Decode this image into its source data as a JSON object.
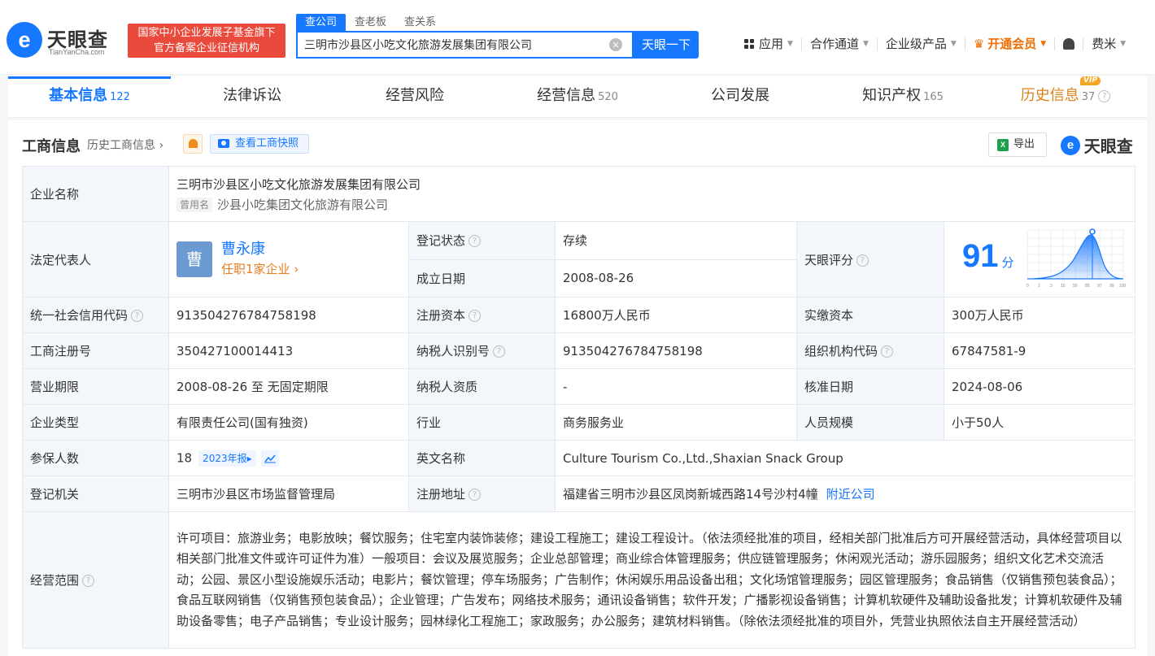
{
  "header": {
    "logo_glyph": "e",
    "logo_text": "天眼查",
    "logo_sub": "TianYanCha.com",
    "slogan_line1": "国家中小企业发展子基金旗下",
    "slogan_line2": "官方备案企业征信机构",
    "search_tabs": [
      "查公司",
      "查老板",
      "查关系"
    ],
    "search_value": "三明市沙县区小吃文化旅游发展集团有限公司",
    "search_clear": "×",
    "search_button": "天眼一下",
    "nav": {
      "apps": "应用",
      "channels": "合作通道",
      "enterprise": "企业级产品",
      "vip": "开通会员",
      "user": "费米"
    }
  },
  "tabs": [
    {
      "label": "基本信息",
      "count": "122"
    },
    {
      "label": "法律诉讼",
      "count": ""
    },
    {
      "label": "经营风险",
      "count": ""
    },
    {
      "label": "经营信息",
      "count": "520"
    },
    {
      "label": "公司发展",
      "count": ""
    },
    {
      "label": "知识产权",
      "count": "165"
    },
    {
      "label": "历史信息",
      "count": "37",
      "badge": "VIP"
    }
  ],
  "section": {
    "title": "工商信息",
    "history_link": "历史工商信息",
    "snapshot": "查看工商快照",
    "export": "导出",
    "brand": "天眼查",
    "brand_glyph": "e"
  },
  "info": {
    "company_name_label": "企业名称",
    "company_name": "三明市沙县区小吃文化旅游发展集团有限公司",
    "former_name_tag": "曾用名",
    "former_name": "沙县小吃集团文化旅游有限公司",
    "legal_rep_label": "法定代表人",
    "legal_avatar": "曹",
    "legal_rep": "曹永康",
    "legal_sub": "任职1家企业",
    "reg_status_label": "登记状态",
    "reg_status": "存续",
    "found_date_label": "成立日期",
    "found_date": "2008-08-26",
    "score_label": "天眼评分",
    "score": "91",
    "score_unit": "分",
    "score_ticks": [
      "0",
      "1",
      "3",
      "15",
      "50",
      "85",
      "97",
      "99",
      "100"
    ],
    "credit_code_label": "统一社会信用代码",
    "credit_code": "913504276784758198",
    "reg_capital_label": "注册资本",
    "reg_capital": "16800万人民币",
    "paid_capital_label": "实缴资本",
    "paid_capital": "300万人民币",
    "reg_no_label": "工商注册号",
    "reg_no": "350427100014413",
    "tax_id_label": "纳税人识别号",
    "tax_id": "913504276784758198",
    "org_code_label": "组织机构代码",
    "org_code": "67847581-9",
    "term_label": "营业期限",
    "term": "2008-08-26 至 无固定期限",
    "taxpayer_qual_label": "纳税人资质",
    "taxpayer_qual": "-",
    "approve_date_label": "核准日期",
    "approve_date": "2024-08-06",
    "type_label": "企业类型",
    "type": "有限责任公司(国有独资)",
    "industry_label": "行业",
    "industry": "商务服务业",
    "staff_label": "人员规模",
    "staff": "小于50人",
    "insured_label": "参保人数",
    "insured": "18",
    "insured_year": "2023年报",
    "english_label": "英文名称",
    "english": "Culture Tourism Co.,Ltd.,Shaxian Snack Group",
    "authority_label": "登记机关",
    "authority": "三明市沙县区市场监督管理局",
    "address_label": "注册地址",
    "address": "福建省三明市沙县区凤岗新城西路14号沙村4幢",
    "nearby": "附近公司",
    "scope_label": "经营范围",
    "scope": "许可项目：旅游业务；电影放映；餐饮服务；住宅室内装饰装修；建设工程施工；建设工程设计。（依法须经批准的项目，经相关部门批准后方可开展经营活动，具体经营项目以相关部门批准文件或许可证件为准）一般项目：会议及展览服务；企业总部管理；商业综合体管理服务；供应链管理服务；休闲观光活动；游乐园服务；组织文化艺术交流活动；公园、景区小型设施娱乐活动；电影片；餐饮管理；停车场服务；广告制作；休闲娱乐用品设备出租；文化场馆管理服务；园区管理服务；食品销售（仅销售预包装食品）；食品互联网销售（仅销售预包装食品）；企业管理；广告发布；网络技术服务；通讯设备销售；软件开发；广播影视设备销售；计算机软硬件及辅助设备批发；计算机软硬件及辅助设备零售；电子产品销售；专业设计服务；园林绿化工程施工；家政服务；办公服务；建筑材料销售。（除依法须经批准的项目外，凭营业执照依法自主开展经营活动）"
  },
  "colors": {
    "brand": "#1677ff",
    "accent": "#e94a3c",
    "vip": "#ee6c00",
    "status_green": "#10a34a"
  }
}
